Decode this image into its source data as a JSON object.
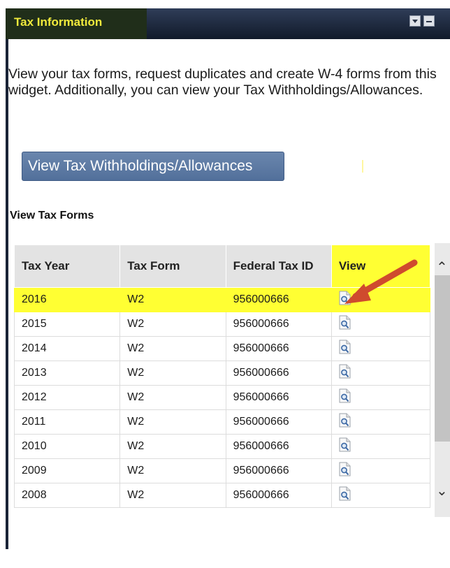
{
  "widget": {
    "title": "Tax Information",
    "intro": "View your tax forms, request duplicates and create W-4 forms from this widget. Additionally, you can view your Tax Withholdings/Allowances.",
    "button_label": "View Tax Withholdings/Allowances",
    "section_title": "View Tax Forms"
  },
  "table": {
    "headers": [
      "Tax Year",
      "Tax Form",
      "Federal Tax ID",
      "View"
    ],
    "rows": [
      {
        "year": "2016",
        "form": "W2",
        "id": "956000666"
      },
      {
        "year": "2015",
        "form": "W2",
        "id": "956000666"
      },
      {
        "year": "2014",
        "form": "W2",
        "id": "956000666"
      },
      {
        "year": "2013",
        "form": "W2",
        "id": "956000666"
      },
      {
        "year": "2012",
        "form": "W2",
        "id": "956000666"
      },
      {
        "year": "2011",
        "form": "W2",
        "id": "956000666"
      },
      {
        "year": "2010",
        "form": "W2",
        "id": "956000666"
      },
      {
        "year": "2009",
        "form": "W2",
        "id": "956000666"
      },
      {
        "year": "2008",
        "form": "W2",
        "id": "956000666"
      }
    ]
  },
  "colors": {
    "header_dark": "#111a2a",
    "title_text": "#f1ea3c",
    "button_blue": "#5a77a2",
    "highlight_yellow": "#ffff33",
    "arrow_red": "#cf4b2e"
  }
}
